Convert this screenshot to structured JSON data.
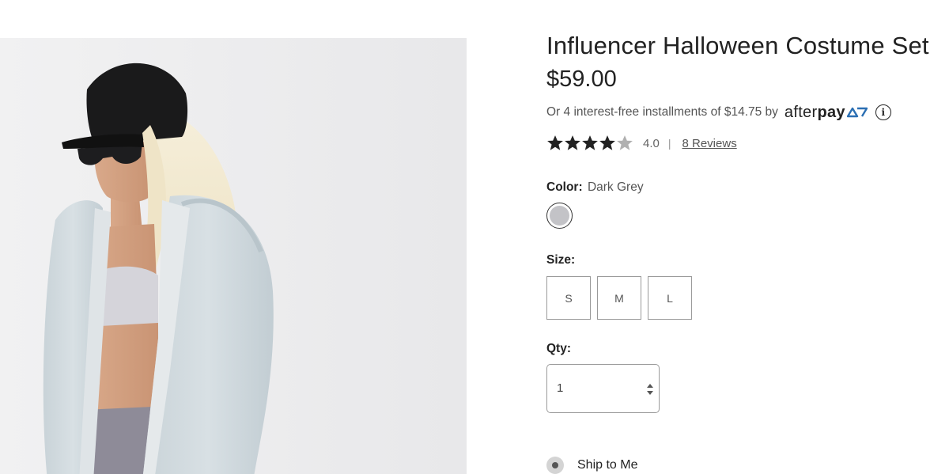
{
  "product": {
    "title": "Influencer Halloween Costume Set",
    "price": "$59.00"
  },
  "afterpay": {
    "text": "Or 4 interest-free installments of $14.75 by",
    "logo_text_after": "after",
    "logo_text_pay": "pay",
    "info_icon": "info-icon"
  },
  "rating": {
    "stars": 4,
    "max_stars": 5,
    "value": "4.0",
    "separator": "|",
    "reviews_label": "8 Reviews"
  },
  "color": {
    "label": "Color:",
    "value": "Dark Grey",
    "swatch_hex": "#c3c3c7"
  },
  "size": {
    "label": "Size:",
    "options": [
      "S",
      "M",
      "L"
    ]
  },
  "qty": {
    "label": "Qty:",
    "value": "1"
  },
  "shipping": {
    "option_label": "Ship to Me"
  },
  "image": {
    "icon": "product-photo"
  },
  "colors": {
    "text": "#222222",
    "muted": "#555555",
    "afterpay_arrow": "#222222",
    "image_bg": "#ececed"
  }
}
